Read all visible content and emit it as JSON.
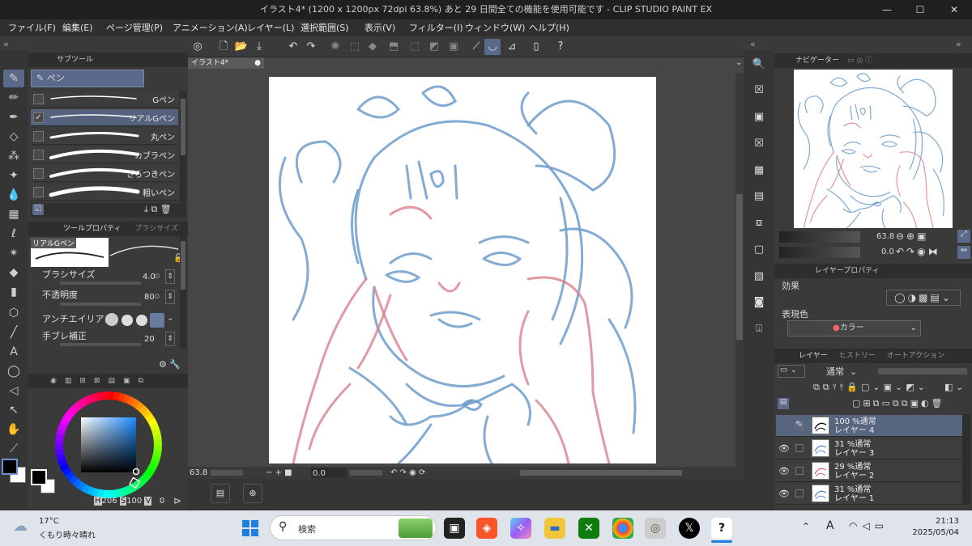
{
  "window": {
    "title": "イラスト4* (1200 x 1200px 72dpi 63.8%) あと 29 日間全ての機能を使用可能です - CLIP STUDIO PAINT EX",
    "minimize": "—",
    "maximize": "☐",
    "close": "✕"
  },
  "menu": [
    "ファイル(F)",
    "編集(E)",
    "ページ管理(P)",
    "アニメーション(A)",
    "レイヤー(L)",
    "選択範囲(S)",
    "表示(V)",
    "フィルター(I)",
    "ウィンドウ(W)",
    "ヘルプ(H)"
  ],
  "subtool": {
    "tab_label": "サブツール",
    "group_label": "ペン",
    "brushes": [
      {
        "name": "Gペン",
        "checked": false,
        "selected": false
      },
      {
        "name": "リアルGペン",
        "checked": true,
        "selected": true
      },
      {
        "name": "丸ペン",
        "checked": false,
        "selected": false
      },
      {
        "name": "カブラペン",
        "checked": false,
        "selected": false
      },
      {
        "name": "ざらつきペン",
        "checked": false,
        "selected": false
      },
      {
        "name": "粗いペン",
        "checked": false,
        "selected": false
      }
    ]
  },
  "toolprop": {
    "tab_label": "ツールプロパティ",
    "tab2_label": "ブラシサイズ",
    "preview_label": "リアルGペン",
    "brush_size_label": "ブラシサイズ",
    "brush_size_value": "4.0",
    "opacity_label": "不透明度",
    "opacity_value": "80",
    "antialias_label": "アンチエイリアス",
    "stabilization_label": "手ブレ補正",
    "stabilization_value": "20"
  },
  "color": {
    "hsv": {
      "h_label": "H",
      "h": "206",
      "s_label": "S",
      "s": "100",
      "v_label": "V",
      "v": "0"
    },
    "main": "#000000",
    "sub": "#ffffff"
  },
  "canvas": {
    "tab_label": "イラスト4*",
    "zoom": "63.8",
    "angle": "0.0"
  },
  "navigator": {
    "tab_label": "ナビゲーター",
    "zoom": "63.8",
    "angle": "0.0"
  },
  "layer_property": {
    "tab_label": "レイヤープロパティ",
    "effect_label": "効果",
    "expression_label": "表現色",
    "expression_value": "カラー"
  },
  "layer_panel": {
    "tabs": [
      "レイヤー",
      "ヒストリー",
      "オートアクション"
    ],
    "blend": "通常",
    "layers": [
      {
        "line1": "100 %通常",
        "line2": "レイヤー 4",
        "visible": false,
        "selected": true,
        "stroke": "#000000"
      },
      {
        "line1": "31 %通常",
        "line2": "レイヤー 3",
        "visible": true,
        "selected": false,
        "stroke": "#5b8fc8"
      },
      {
        "line1": "29 %通常",
        "line2": "レイヤー 2",
        "visible": true,
        "selected": false,
        "stroke": "#d86a7a"
      },
      {
        "line1": "31 %通常",
        "line2": "レイヤー 1",
        "visible": true,
        "selected": false,
        "stroke": "#5b8fc8"
      }
    ]
  },
  "taskbar": {
    "weather_temp": "17°C",
    "weather_desc": "くもり時々晴れ",
    "search_placeholder": "検索",
    "time": "21:13",
    "date": "2025/05/04",
    "ime": "A"
  },
  "sketch_colors": {
    "blue": "#6f9ccc",
    "red": "#d9808c"
  }
}
